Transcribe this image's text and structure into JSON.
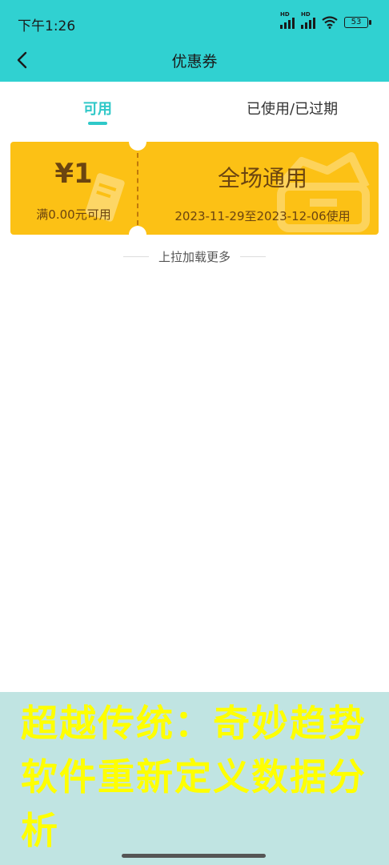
{
  "status_bar": {
    "time": "下午1:26",
    "network_label": "HD",
    "battery": "53"
  },
  "nav": {
    "title": "优惠券"
  },
  "tabs": [
    {
      "label": "可用",
      "active": true
    },
    {
      "label": "已使用/已过期",
      "active": false
    }
  ],
  "coupon": {
    "amount": "¥1",
    "condition": "满0.00元可用",
    "scope": "全场通用",
    "validity": "2023-11-29至2023-12-06使用"
  },
  "load_more": "上拉加载更多",
  "banner": {
    "text": "超越传统：奇妙趋势软件重新定义数据分析"
  },
  "colors": {
    "accent": "#30d1d1",
    "coupon_bg": "#fcc115",
    "coupon_text": "#6b4410",
    "banner_bg": "#c0e4e2",
    "banner_text": "#ffff00"
  },
  "icons": [
    "back-arrow-icon",
    "signal-icon",
    "wifi-icon",
    "battery-icon"
  ]
}
